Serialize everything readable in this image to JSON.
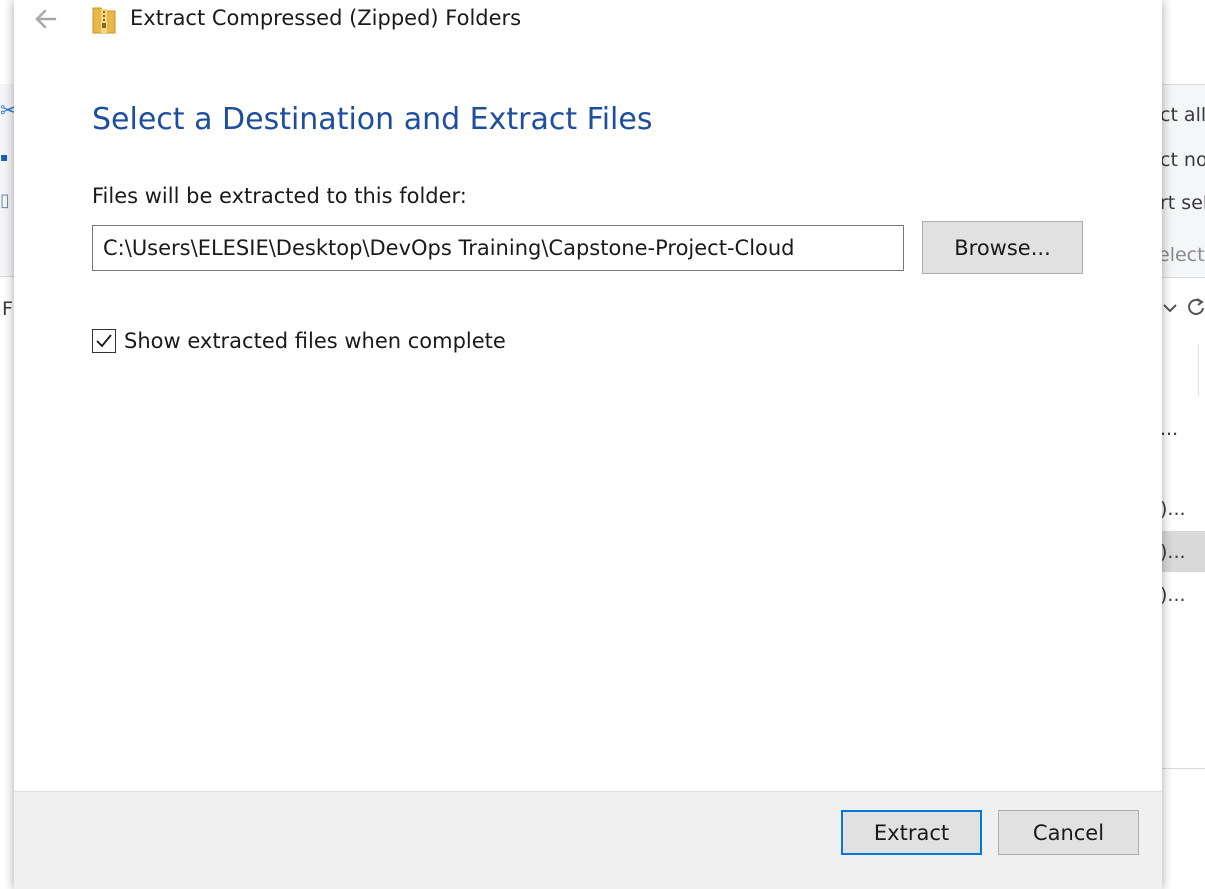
{
  "dialog": {
    "title": "Extract Compressed (Zipped) Folders",
    "heading": "Select a Destination and Extract Files",
    "folder_label": "Files will be extracted to this folder:",
    "destination_path": "C:\\Users\\ELESIE\\Desktop\\DevOps Training\\Capstone-Project-Cloud",
    "browse_label": "Browse...",
    "show_files_label": "Show extracted files when complete",
    "show_files_checked": true,
    "extract_label": "Extract",
    "cancel_label": "Cancel"
  },
  "background_window": {
    "ribbon_items": [
      "ct all",
      "ct non",
      "rt sele",
      "elect"
    ],
    "left_fragment": "F",
    "file_list_fragments": [
      "...",
      ")...",
      ")...",
      ")..."
    ],
    "accent_color": "#2b79d8"
  },
  "colors": {
    "heading": "#1e4e9f",
    "focus_border": "#0078d7",
    "footer_bg": "#f0f0f0",
    "button_bg": "#e1e1e1"
  },
  "icons": [
    "back-arrow-icon",
    "zip-folder-icon",
    "checkmark-icon",
    "chevron-down-icon",
    "refresh-icon"
  ]
}
